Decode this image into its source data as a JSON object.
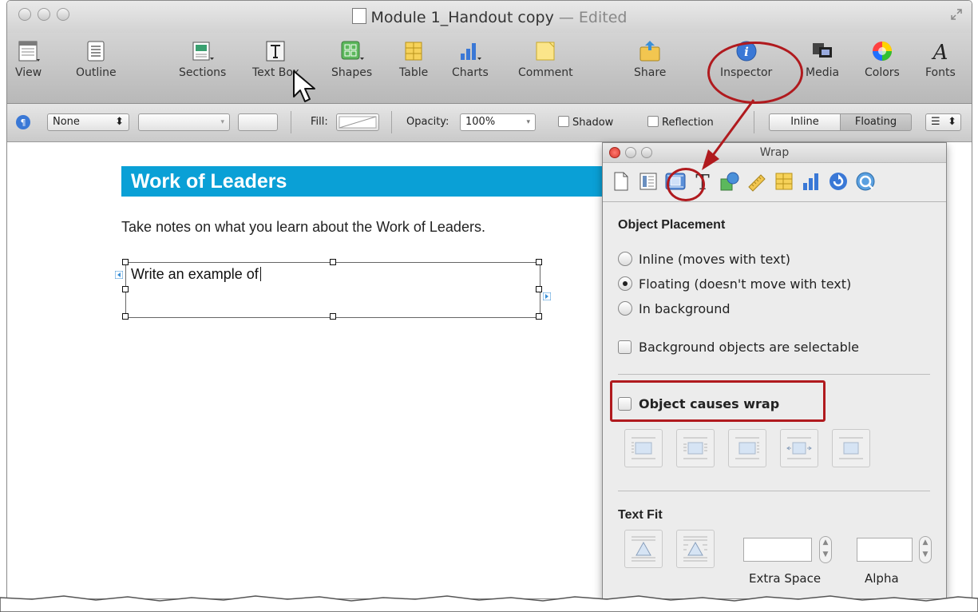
{
  "window": {
    "title": "Module 1_Handout copy",
    "title_separator": "—",
    "status": "Edited"
  },
  "toolbar": {
    "items": [
      {
        "label": "View",
        "icon": "view-icon"
      },
      {
        "label": "Outline",
        "icon": "outline-icon"
      },
      {
        "label": "Sections",
        "icon": "sections-icon"
      },
      {
        "label": "Text Box",
        "icon": "text-box-icon"
      },
      {
        "label": "Shapes",
        "icon": "shapes-icon"
      },
      {
        "label": "Table",
        "icon": "table-icon"
      },
      {
        "label": "Charts",
        "icon": "charts-icon"
      },
      {
        "label": "Comment",
        "icon": "comment-icon"
      },
      {
        "label": "Share",
        "icon": "share-icon"
      },
      {
        "label": "Inspector",
        "icon": "inspector-icon"
      },
      {
        "label": "Media",
        "icon": "media-icon"
      },
      {
        "label": "Colors",
        "icon": "colors-icon"
      },
      {
        "label": "Fonts",
        "icon": "fonts-icon"
      }
    ]
  },
  "format_bar": {
    "paragraph_style": "None",
    "fill_label": "Fill:",
    "opacity_label": "Opacity:",
    "opacity_value": "100%",
    "shadow_label": "Shadow",
    "reflection_label": "Reflection",
    "inline_label": "Inline",
    "floating_label": "Floating"
  },
  "document": {
    "heading": "Work of Leaders",
    "body": "Take notes on what you learn about the Work of Leaders.",
    "textbox_content": "Write an example of"
  },
  "inspector": {
    "title": "Wrap",
    "object_placement": {
      "heading": "Object Placement",
      "options": [
        {
          "label": "Inline (moves with text)",
          "selected": false
        },
        {
          "label": "Floating (doesn't move with text)",
          "selected": true
        },
        {
          "label": "In background",
          "selected": false
        }
      ],
      "bg_selectable_label": "Background objects are selectable"
    },
    "object_causes_wrap_label": "Object causes wrap",
    "text_fit": {
      "heading": "Text Fit",
      "extra_space_label": "Extra Space",
      "alpha_label": "Alpha"
    }
  },
  "colors": {
    "heading_bg": "#0aa0d6",
    "annotation": "#b01a1e",
    "inspector_icon": "#3a78d6"
  }
}
